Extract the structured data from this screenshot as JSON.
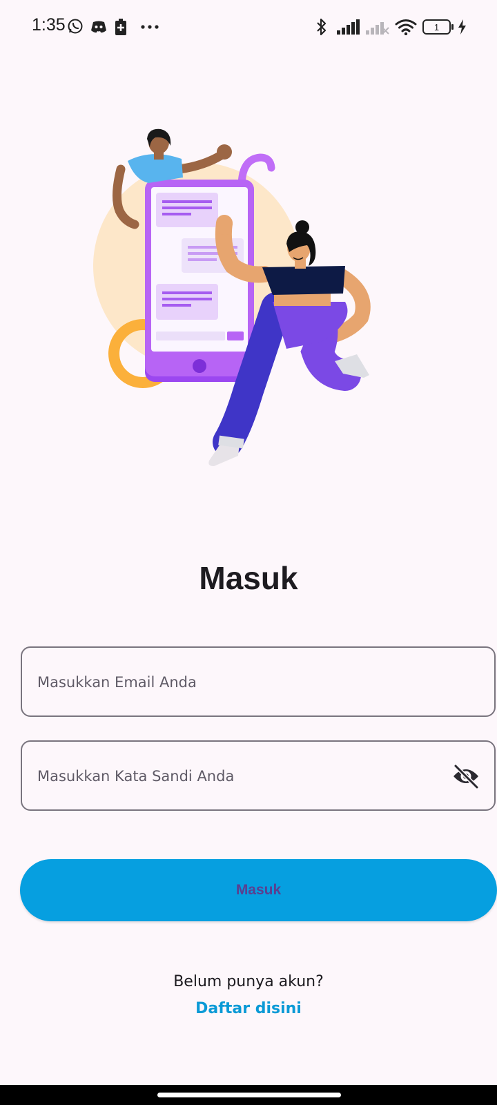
{
  "status_bar": {
    "time": "1:35",
    "left_icons": [
      "whatsapp-icon",
      "discord-icon",
      "battery-saver-icon",
      "more-dots-icon"
    ],
    "right_icons": [
      "bluetooth-icon",
      "signal-icon",
      "signal-no-service-icon",
      "wifi-icon",
      "battery-icon",
      "charging-icon"
    ],
    "battery_level": "1"
  },
  "login": {
    "title": "Masuk",
    "email_placeholder": "Masukkan Email Anda",
    "password_placeholder": "Masukkan Kata Sandi Anda",
    "submit_label": "Masuk",
    "no_account_text": "Belum punya akun?",
    "register_link": "Daftar disini"
  },
  "colors": {
    "background": "#fdf7fb",
    "primary_button": "#069fe0",
    "button_text": "#5b3f90",
    "link": "#0a9ad6",
    "field_border": "#79747e"
  }
}
